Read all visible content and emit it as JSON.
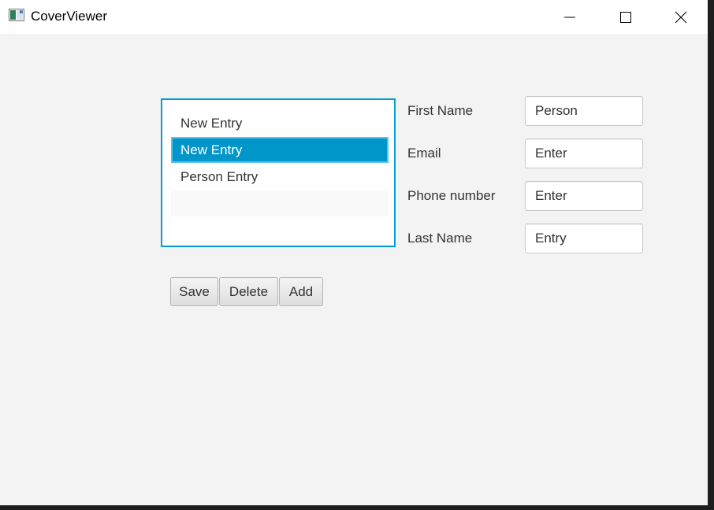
{
  "window": {
    "title": "CoverViewer",
    "icon": "java-app-icon"
  },
  "list": {
    "items": [
      {
        "label": "New Entry",
        "selected": false
      },
      {
        "label": "New Entry",
        "selected": true
      },
      {
        "label": "Person Entry",
        "selected": false
      },
      {
        "label": "",
        "selected": false
      }
    ]
  },
  "form": {
    "fields": [
      {
        "label": "First Name",
        "value": "Person"
      },
      {
        "label": "Email",
        "value": "Enter"
      },
      {
        "label": "Phone number",
        "value": "Enter"
      },
      {
        "label": "Last Name",
        "value": "Entry"
      }
    ]
  },
  "buttons": {
    "save": "Save",
    "delete": "Delete",
    "add": "Add"
  },
  "colors": {
    "background": "#f3f3f3",
    "selection": "#0096c9",
    "focus_border": "#039ed3"
  }
}
